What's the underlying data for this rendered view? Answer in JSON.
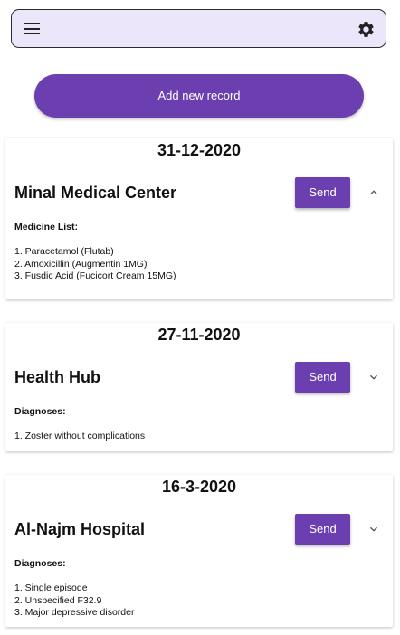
{
  "header": {
    "menu_icon": "hamburger-menu-icon",
    "settings_icon": "gear-icon"
  },
  "add_button": {
    "label": "Add new record"
  },
  "records": [
    {
      "date": "31-12-2020",
      "facility": "Minal Medical Center",
      "send_label": "Send",
      "section_label": "Medicine List:",
      "expanded": true,
      "items": [
        "1. Paracetamol (Flutab)",
        "2. Amoxicillin (Augmentin 1MG)",
        "3. Fusdic Acid (Fucicort Cream 15MG)"
      ]
    },
    {
      "date": "27-11-2020",
      "facility": "Health Hub",
      "send_label": "Send",
      "section_label": "Diagnoses:",
      "expanded": false,
      "items": [
        "1. Zoster without complications"
      ]
    },
    {
      "date": "16-3-2020",
      "facility": "Al-Najm Hospital",
      "send_label": "Send",
      "section_label": "Diagnoses:",
      "expanded": false,
      "items": [
        "1. Single episode",
        "2. Unspecified F32.9",
        "3. Major depressive disorder"
      ]
    }
  ],
  "colors": {
    "primary": "#6b3fb0",
    "header_bg": "#ece6fb"
  }
}
